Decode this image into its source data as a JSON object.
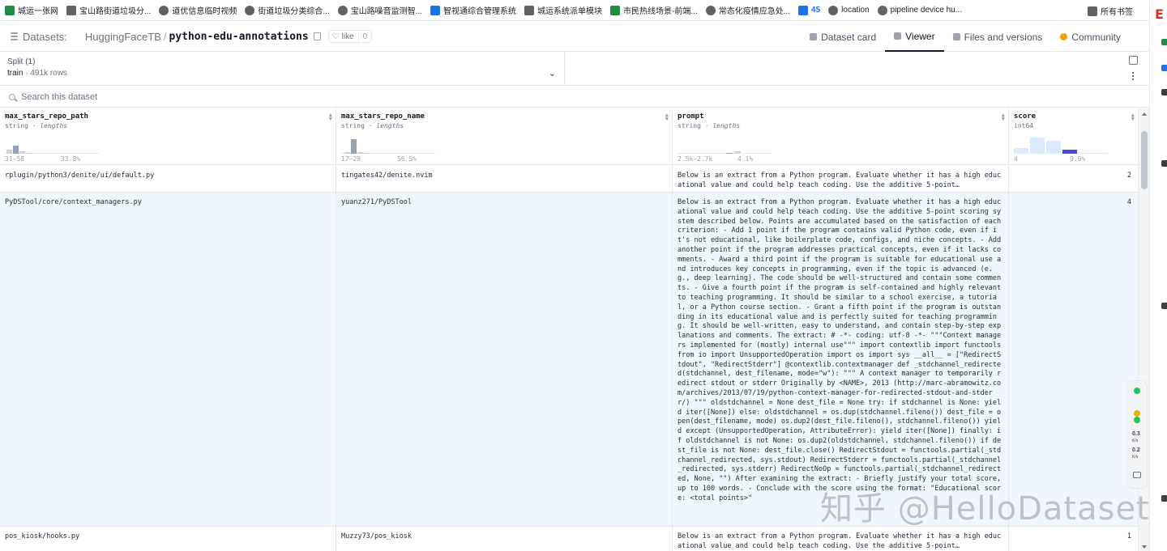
{
  "bookmarks": [
    {
      "label": "城运一张网",
      "icon": "vue-icon"
    },
    {
      "label": "宝山路街道垃圾分...",
      "icon": "page-icon"
    },
    {
      "label": "道优信息临时视频",
      "icon": "globe-icon"
    },
    {
      "label": "街道垃圾分类综合...",
      "icon": "globe-icon"
    },
    {
      "label": "宝山路噪音监测智...",
      "icon": "globe-icon"
    },
    {
      "label": "智视通综合管理系统",
      "icon": "monitor-icon"
    },
    {
      "label": "城运系统派单模块",
      "icon": "chart-icon"
    },
    {
      "label": "市民热线场景-前端...",
      "icon": "leaf-icon"
    },
    {
      "label": "常态化疫情应急处...",
      "icon": "globe-icon"
    },
    {
      "label": "45",
      "icon": "number-icon"
    },
    {
      "label": "location",
      "icon": "paw-icon"
    },
    {
      "label": "pipeline device hu...",
      "icon": "search-icon"
    }
  ],
  "bookmarks_folder": "所有书签",
  "header": {
    "section_label": "Datasets:",
    "org": "HuggingFaceTB",
    "separator": "/",
    "dataset_name": "python-edu-annotations",
    "like_label": "like",
    "like_count": "0",
    "tabs": [
      {
        "label": "Dataset card",
        "active": false
      },
      {
        "label": "Viewer",
        "active": true
      },
      {
        "label": "Files and versions",
        "active": false
      },
      {
        "label": "Community",
        "active": false
      }
    ]
  },
  "split": {
    "title": "Split (1)",
    "name": "train",
    "dot": "·",
    "rows": "491k rows"
  },
  "search": {
    "placeholder": "Search this dataset"
  },
  "columns": [
    {
      "name": "max_stars_repo_path",
      "type": "string",
      "stat": "lengths",
      "range": "31–58",
      "pct": "33.8%"
    },
    {
      "name": "max_stars_repo_name",
      "type": "string",
      "stat": "lengths",
      "range": "17–29",
      "pct": "56.5%"
    },
    {
      "name": "prompt",
      "type": "string",
      "stat": "lengths",
      "range": "2.5k–2.7k",
      "pct": "4.1%"
    },
    {
      "name": "score",
      "type": "int64",
      "stat": "",
      "range": "4",
      "pct": "9.9%"
    }
  ],
  "rows": [
    {
      "path": "rplugin/python3/denite/ui/default.py",
      "repo": "tingates42/denite.nvim",
      "prompt": "Below is an extract from a Python program. Evaluate whether it has a high educational value and could help teach coding. Use the additive 5-point…",
      "score": "2"
    },
    {
      "path": "PyDSTool/core/context_managers.py",
      "repo": "yuanz271/PyDSTool",
      "prompt": "Below is an extract from a Python program. Evaluate whether it has a high educational value and could help teach coding. Use the additive 5-point scoring system described below. Points are accumulated based on the satisfaction of each criterion: - Add 1 point if the program contains valid Python code, even if it's not educational, like boilerplate code, configs, and niche concepts. - Add another point if the program addresses practical concepts, even if it lacks comments. - Award a third point if the program is suitable for educational use and introduces key concepts in programming, even if the topic is advanced (e.g., deep learning). The code should be well-structured and contain some comments. - Give a fourth point if the program is self-contained and highly relevant to teaching programming. It should be similar to a school exercise, a tutorial, or a Python course section. - Grant a fifth point if the program is outstanding in its educational value and is perfectly suited for teaching programming. It should be well-written, easy to understand, and contain step-by-step explanations and comments. The extract: # -*- coding: utf-8 -*- \"\"\"Context managers implemented for (mostly) internal use\"\"\" import contextlib import functools from io import UnsupportedOperation import os import sys __all__ = [\"RedirectStdout\", \"RedirectStderr\"] @contextlib.contextmanager def _stdchannel_redirected(stdchannel, dest_filename, mode=\"w\"): \"\"\" A context manager to temporarily redirect stdout or stderr Originally by <NAME>, 2013 (http://marc-abramowitz.com/archives/2013/07/19/python-context-manager-for-redirected-stdout-and-stderr/) \"\"\" oldstdchannel = None dest_file = None try: if stdchannel is None: yield iter([None]) else: oldstdchannel = os.dup(stdchannel.fileno()) dest_file = open(dest_filename, mode) os.dup2(dest_file.fileno(), stdchannel.fileno()) yield except (UnsupportedOperation, AttributeError): yield iter([None]) finally: if oldstdchannel is not None: os.dup2(oldstdchannel, stdchannel.fileno()) if dest_file is not None: dest_file.close() RedirectStdout = functools.partial(_stdchannel_redirected, sys.stdout) RedirectStderr = functools.partial(_stdchannel_redirected, sys.stderr) RedirectNoOp = functools.partial(_stdchannel_redirected, None, \"\") After examining the extract: - Briefly justify your total score, up to 100 words. - Conclude with the score using the format: \"Educational score: <total points>\"",
      "score": "4"
    },
    {
      "path": "pos_kiosk/hooks.py",
      "repo": "Muzzy73/pos_kiosk",
      "prompt": "Below is an extract from a Python program. Evaluate whether it has a high educational value and could help teach coding. Use the additive 5-point…",
      "score": "1"
    }
  ],
  "speed_widget": {
    "up": "0.3",
    "down": "0.2",
    "unit": "K/s"
  },
  "watermark": "知乎 @HelloDataset"
}
